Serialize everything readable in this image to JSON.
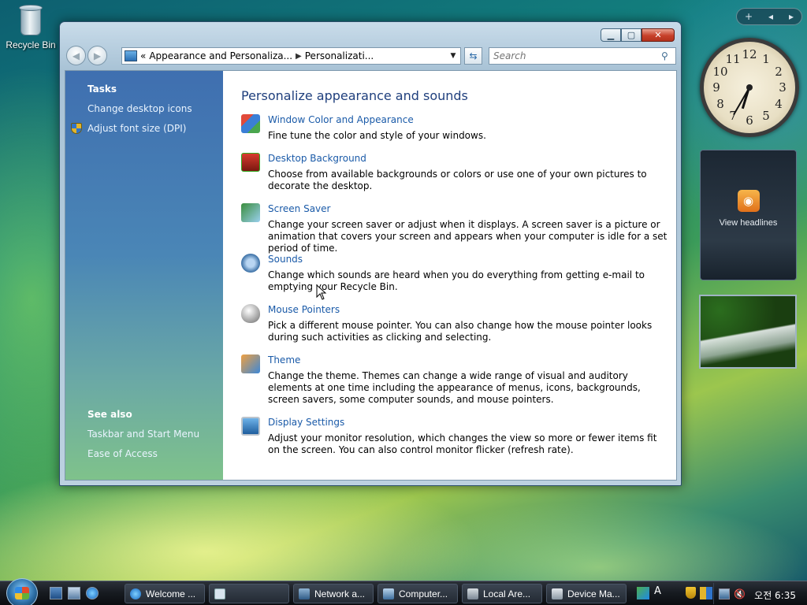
{
  "desktop": {
    "recycle_bin_label": "Recycle Bin"
  },
  "window": {
    "address": {
      "prefix": "«",
      "segment1": "Appearance and Personaliza...",
      "segment2": "Personalizati..."
    },
    "search": {
      "placeholder": "Search"
    },
    "sidebar": {
      "tasks_title": "Tasks",
      "task_links": [
        "Change desktop icons",
        "Adjust font size (DPI)"
      ],
      "see_also_title": "See also",
      "see_also_links": [
        "Taskbar and Start Menu",
        "Ease of Access"
      ]
    },
    "main": {
      "title": "Personalize appearance and sounds",
      "items": [
        {
          "icon": "window-color-icon",
          "link": "Window Color and Appearance",
          "desc": "Fine tune the color and style of your windows."
        },
        {
          "icon": "desktop-background-icon",
          "link": "Desktop Background",
          "desc": "Choose from available backgrounds or colors or use one of your own pictures to decorate the desktop."
        },
        {
          "icon": "screen-saver-icon",
          "link": "Screen Saver",
          "desc": "Change your screen saver or adjust when it displays. A screen saver is a picture or animation that covers your screen and appears when your computer is idle for a set period of time."
        },
        {
          "icon": "sounds-icon",
          "link": "Sounds",
          "desc": "Change which sounds are heard when you do everything from getting e-mail to emptying your Recycle Bin."
        },
        {
          "icon": "mouse-pointers-icon",
          "link": "Mouse Pointers",
          "desc": "Pick a different mouse pointer. You can also change how the mouse pointer looks during such activities as clicking and selecting."
        },
        {
          "icon": "theme-icon",
          "link": "Theme",
          "desc": "Change the theme. Themes can change a wide range of visual and auditory elements at one time including the appearance of menus, icons, backgrounds, screen savers, some computer sounds, and mouse pointers."
        },
        {
          "icon": "display-settings-icon",
          "link": "Display Settings",
          "desc": "Adjust your monitor resolution, which changes the view so more or fewer items fit on the screen. You can also control monitor flicker (refresh rate)."
        }
      ]
    }
  },
  "gadgets": {
    "controls": {
      "add": "+",
      "prev": "◂",
      "next": "▸"
    },
    "clock": {
      "numbers": [
        "12",
        "1",
        "2",
        "3",
        "4",
        "5",
        "6",
        "7",
        "8",
        "9",
        "10",
        "11"
      ],
      "time": "6:35"
    },
    "feed": {
      "label": "View headlines"
    }
  },
  "taskbar": {
    "buttons": [
      "Welcome ...",
      "",
      "Network a...",
      "Computer...",
      "Local Are...",
      "Device Ma..."
    ],
    "tray_time": "오전 6:35"
  },
  "colors": {
    "link": "#1a5aa8",
    "title": "#1f3f7d",
    "sidebar_top": "#3f6fb0",
    "sidebar_bottom": "#7fc28b"
  }
}
